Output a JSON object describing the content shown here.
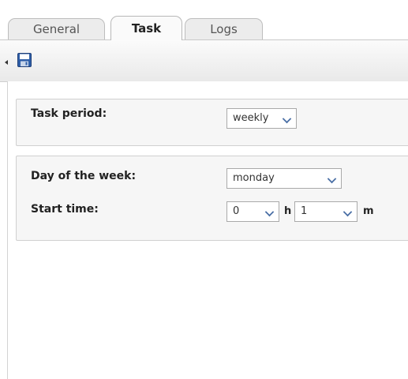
{
  "tabs": [
    {
      "label": "General"
    },
    {
      "label": "Task",
      "active": true
    },
    {
      "label": "Logs"
    }
  ],
  "toolbar": {
    "icons": [
      "collapse-arrow-icon",
      "save-icon"
    ]
  },
  "task_period": {
    "label": "Task period:",
    "value": "weekly"
  },
  "schedule": {
    "day_label": "Day of the week:",
    "day_value": "monday",
    "start_label": "Start time:",
    "hour_value": "0",
    "hour_unit": "h",
    "minute_value": "1",
    "minute_unit": "m"
  },
  "colors": {
    "fieldset_bg": "#f6f6f6",
    "chevron": "#4a6fa5",
    "save_icon": "#2f5fa8"
  }
}
